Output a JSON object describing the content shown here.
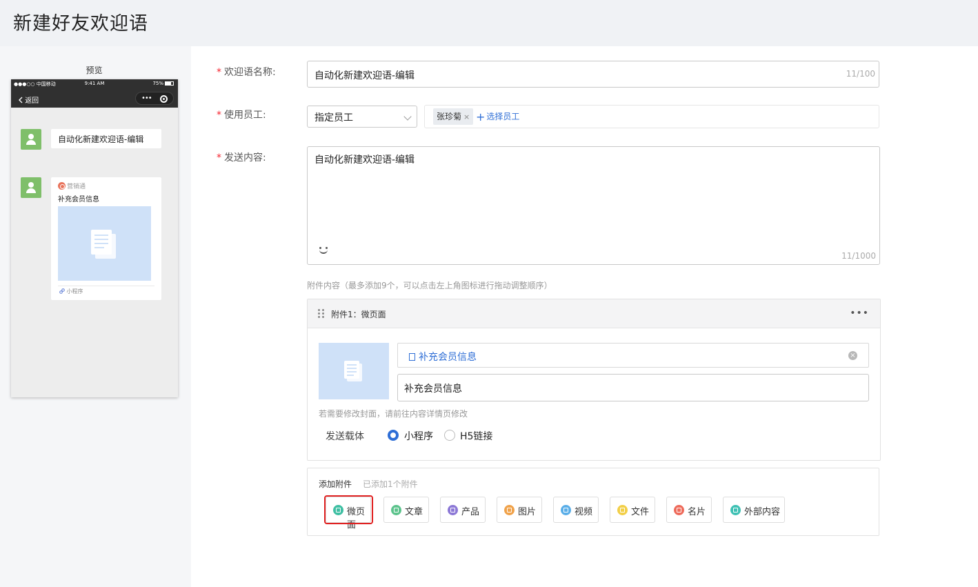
{
  "page": {
    "title": "新建好友欢迎语"
  },
  "preview": {
    "label": "预览",
    "status": {
      "signal": "●●●○○ 中国移动 ",
      "time": "9:41 AM",
      "battery": "75%"
    },
    "nav": {
      "back": "返回",
      "dots": "•••"
    },
    "bubble_text": "自动化新建欢迎语-编辑",
    "card": {
      "source": "营销通",
      "title": "补充会员信息",
      "footer": "小程序"
    }
  },
  "form": {
    "name": {
      "label": "欢迎语名称:",
      "value": "自动化新建欢迎语-编辑",
      "counter": "11/100"
    },
    "staff": {
      "label": "使用员工:",
      "select_value": "指定员工",
      "tag": "张珍菊",
      "tag_close": "×",
      "add_label": "选择员工",
      "add_plus": "+"
    },
    "content": {
      "label": "发送内容:",
      "value": "自动化新建欢迎语-编辑",
      "counter": "11/1000"
    },
    "attachments_hint": "附件内容（最多添加9个，可以点击左上角图标进行拖动调整顺序）",
    "attachment": {
      "title": "附件1：微页面",
      "more": "•••",
      "link_text": "补充会员信息",
      "clear": "×",
      "title_value": "补充会员信息",
      "cover_hint": "若需要修改封面，请前往内容详情页修改",
      "carrier_label": "发送载体",
      "carrier_options": [
        "小程序",
        "H5链接"
      ],
      "carrier_selected": "小程序"
    },
    "add_attachment": {
      "title": "添加附件",
      "count": "已添加1个附件",
      "buttons": [
        {
          "label": "微页面",
          "color": "#3fbfa3"
        },
        {
          "label": "文章",
          "color": "#5cc38c"
        },
        {
          "label": "产品",
          "color": "#8c78d6"
        },
        {
          "label": "图片",
          "color": "#f0a24a"
        },
        {
          "label": "视频",
          "color": "#5aaee8"
        },
        {
          "label": "文件",
          "color": "#f2cf48"
        },
        {
          "label": "名片",
          "color": "#ee6b5b"
        },
        {
          "label": "外部内容",
          "color": "#3fc1b4"
        }
      ]
    }
  }
}
